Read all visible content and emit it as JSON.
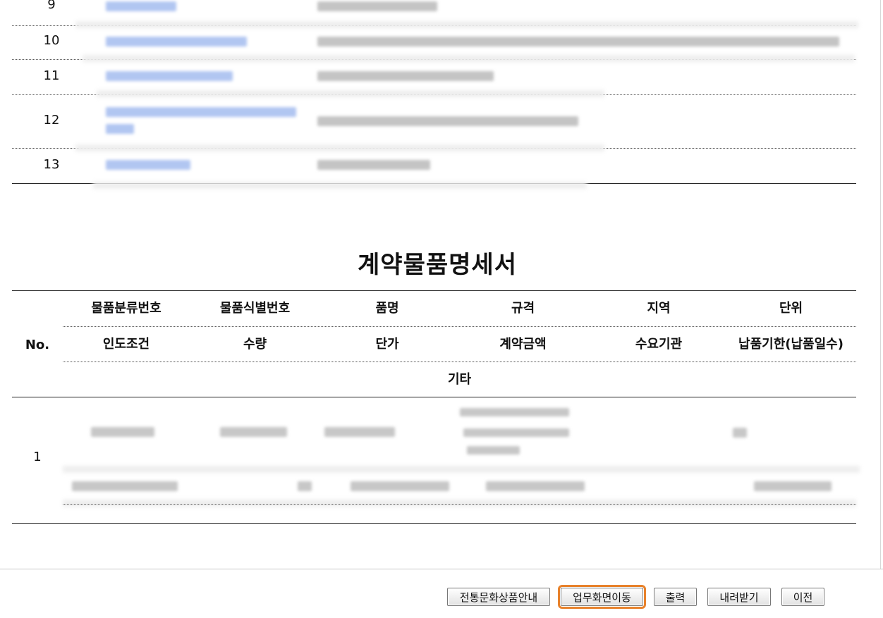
{
  "list": {
    "rows": [
      {
        "no": "9"
      },
      {
        "no": "10"
      },
      {
        "no": "11"
      },
      {
        "no": "12"
      },
      {
        "no": "13"
      }
    ]
  },
  "contract": {
    "title": "계약물품명세서",
    "no_header": "No.",
    "header_row1": [
      "물품분류번호",
      "물품식별번호",
      "품명",
      "규격",
      "지역",
      "단위"
    ],
    "header_row2": [
      "인도조건",
      "수량",
      "단가",
      "계약금액",
      "수요기관",
      "납품기한(납품일수)"
    ],
    "header_row3": "기타",
    "rows": [
      {
        "no": "1"
      }
    ]
  },
  "buttons": {
    "traditional": "전통문화상품안내",
    "business": "업무화면이동",
    "print": "출력",
    "download": "내려받기",
    "prev": "이전"
  },
  "colors": {
    "focus_outline": "#e8822c",
    "redacted_link": "#a9c0f0",
    "redacted_text": "#c4c4c4"
  }
}
